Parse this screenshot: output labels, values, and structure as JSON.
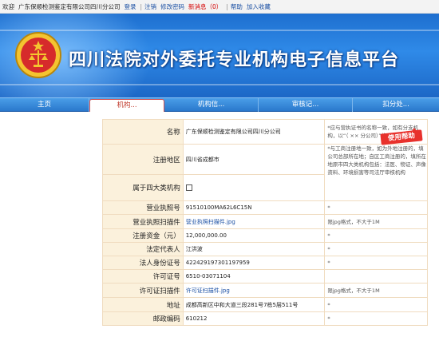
{
  "topbar": {
    "welcome": "欢迎",
    "company": "广东保顺检测鉴定有限公司四川分公司",
    "login": "登录",
    "logout": "注销",
    "change_password": "修改密码",
    "new_messages": "新消息（0）",
    "help": "帮助",
    "favorite": "加入收藏"
  },
  "banner": {
    "title": "四川法院对外委托专业机构电子信息平台"
  },
  "nav": {
    "items": [
      "主页",
      "机构...",
      "机构信...",
      "审核记...",
      "扣分处..."
    ],
    "active_index": 1
  },
  "help_badge": "使用帮助",
  "form": {
    "rows": [
      {
        "label": "名称",
        "value": "广东保顺检测鉴定有限公司四川分公司",
        "note": "*应与营执证书的名称一致，如有分支机构，以“（ ×× 分公司）”格式填写"
      },
      {
        "label": "注册地区",
        "value": "四川省成都市",
        "note": "*与工商注册地一致，如为外地注册的，填公司总部所在地；自区工商注册的，填所在地原市四大类机构包括：法医、物证、声像资料、环境损害等司法厅审核机构"
      },
      {
        "label": "属于四大类机构",
        "value": "",
        "note": ""
      },
      {
        "label": "营业执照号",
        "value": "91510100MA62L6C15N",
        "note": "*"
      },
      {
        "label": "营业执照扫描件",
        "value": "营业执照扫描件.jpg",
        "note": "限jpg格式，不大于1M"
      },
      {
        "label": "注册资金（元）",
        "value": "12,000,000.00",
        "note": "*"
      },
      {
        "label": "法定代表人",
        "value": "江洪波",
        "note": "*"
      },
      {
        "label": "法人身份证号",
        "value": "422429197301197959",
        "note": "*"
      },
      {
        "label": "许可证号",
        "value": "6510-03071104",
        "note": ""
      },
      {
        "label": "许可证扫描件",
        "value": "许可证扫描件.jpg",
        "note": "限jpg格式，不大于1M"
      },
      {
        "label": "地址",
        "value": "成都高新区中和大道三段281号7栋5层511号",
        "note": "*"
      },
      {
        "label": "邮政编码",
        "value": "610212",
        "note": "*"
      }
    ]
  }
}
